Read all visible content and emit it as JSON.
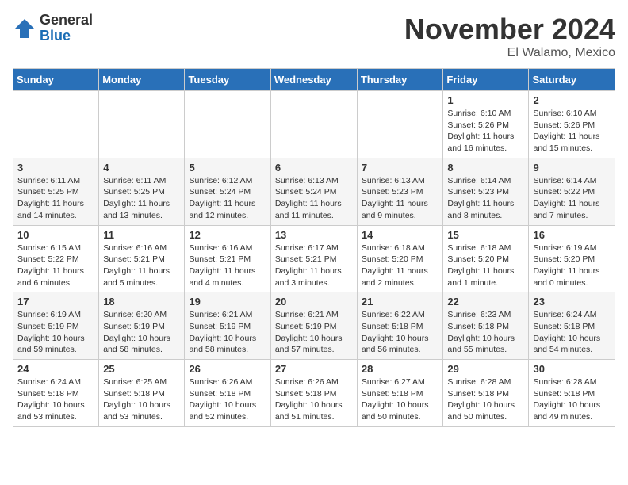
{
  "logo": {
    "general": "General",
    "blue": "Blue"
  },
  "header": {
    "month": "November 2024",
    "location": "El Walamo, Mexico"
  },
  "days_of_week": [
    "Sunday",
    "Monday",
    "Tuesday",
    "Wednesday",
    "Thursday",
    "Friday",
    "Saturday"
  ],
  "weeks": [
    [
      {
        "day": "",
        "info": ""
      },
      {
        "day": "",
        "info": ""
      },
      {
        "day": "",
        "info": ""
      },
      {
        "day": "",
        "info": ""
      },
      {
        "day": "",
        "info": ""
      },
      {
        "day": "1",
        "info": "Sunrise: 6:10 AM\nSunset: 5:26 PM\nDaylight: 11 hours and 16 minutes."
      },
      {
        "day": "2",
        "info": "Sunrise: 6:10 AM\nSunset: 5:26 PM\nDaylight: 11 hours and 15 minutes."
      }
    ],
    [
      {
        "day": "3",
        "info": "Sunrise: 6:11 AM\nSunset: 5:25 PM\nDaylight: 11 hours and 14 minutes."
      },
      {
        "day": "4",
        "info": "Sunrise: 6:11 AM\nSunset: 5:25 PM\nDaylight: 11 hours and 13 minutes."
      },
      {
        "day": "5",
        "info": "Sunrise: 6:12 AM\nSunset: 5:24 PM\nDaylight: 11 hours and 12 minutes."
      },
      {
        "day": "6",
        "info": "Sunrise: 6:13 AM\nSunset: 5:24 PM\nDaylight: 11 hours and 11 minutes."
      },
      {
        "day": "7",
        "info": "Sunrise: 6:13 AM\nSunset: 5:23 PM\nDaylight: 11 hours and 9 minutes."
      },
      {
        "day": "8",
        "info": "Sunrise: 6:14 AM\nSunset: 5:23 PM\nDaylight: 11 hours and 8 minutes."
      },
      {
        "day": "9",
        "info": "Sunrise: 6:14 AM\nSunset: 5:22 PM\nDaylight: 11 hours and 7 minutes."
      }
    ],
    [
      {
        "day": "10",
        "info": "Sunrise: 6:15 AM\nSunset: 5:22 PM\nDaylight: 11 hours and 6 minutes."
      },
      {
        "day": "11",
        "info": "Sunrise: 6:16 AM\nSunset: 5:21 PM\nDaylight: 11 hours and 5 minutes."
      },
      {
        "day": "12",
        "info": "Sunrise: 6:16 AM\nSunset: 5:21 PM\nDaylight: 11 hours and 4 minutes."
      },
      {
        "day": "13",
        "info": "Sunrise: 6:17 AM\nSunset: 5:21 PM\nDaylight: 11 hours and 3 minutes."
      },
      {
        "day": "14",
        "info": "Sunrise: 6:18 AM\nSunset: 5:20 PM\nDaylight: 11 hours and 2 minutes."
      },
      {
        "day": "15",
        "info": "Sunrise: 6:18 AM\nSunset: 5:20 PM\nDaylight: 11 hours and 1 minute."
      },
      {
        "day": "16",
        "info": "Sunrise: 6:19 AM\nSunset: 5:20 PM\nDaylight: 11 hours and 0 minutes."
      }
    ],
    [
      {
        "day": "17",
        "info": "Sunrise: 6:19 AM\nSunset: 5:19 PM\nDaylight: 10 hours and 59 minutes."
      },
      {
        "day": "18",
        "info": "Sunrise: 6:20 AM\nSunset: 5:19 PM\nDaylight: 10 hours and 58 minutes."
      },
      {
        "day": "19",
        "info": "Sunrise: 6:21 AM\nSunset: 5:19 PM\nDaylight: 10 hours and 58 minutes."
      },
      {
        "day": "20",
        "info": "Sunrise: 6:21 AM\nSunset: 5:19 PM\nDaylight: 10 hours and 57 minutes."
      },
      {
        "day": "21",
        "info": "Sunrise: 6:22 AM\nSunset: 5:18 PM\nDaylight: 10 hours and 56 minutes."
      },
      {
        "day": "22",
        "info": "Sunrise: 6:23 AM\nSunset: 5:18 PM\nDaylight: 10 hours and 55 minutes."
      },
      {
        "day": "23",
        "info": "Sunrise: 6:24 AM\nSunset: 5:18 PM\nDaylight: 10 hours and 54 minutes."
      }
    ],
    [
      {
        "day": "24",
        "info": "Sunrise: 6:24 AM\nSunset: 5:18 PM\nDaylight: 10 hours and 53 minutes."
      },
      {
        "day": "25",
        "info": "Sunrise: 6:25 AM\nSunset: 5:18 PM\nDaylight: 10 hours and 53 minutes."
      },
      {
        "day": "26",
        "info": "Sunrise: 6:26 AM\nSunset: 5:18 PM\nDaylight: 10 hours and 52 minutes."
      },
      {
        "day": "27",
        "info": "Sunrise: 6:26 AM\nSunset: 5:18 PM\nDaylight: 10 hours and 51 minutes."
      },
      {
        "day": "28",
        "info": "Sunrise: 6:27 AM\nSunset: 5:18 PM\nDaylight: 10 hours and 50 minutes."
      },
      {
        "day": "29",
        "info": "Sunrise: 6:28 AM\nSunset: 5:18 PM\nDaylight: 10 hours and 50 minutes."
      },
      {
        "day": "30",
        "info": "Sunrise: 6:28 AM\nSunset: 5:18 PM\nDaylight: 10 hours and 49 minutes."
      }
    ]
  ]
}
